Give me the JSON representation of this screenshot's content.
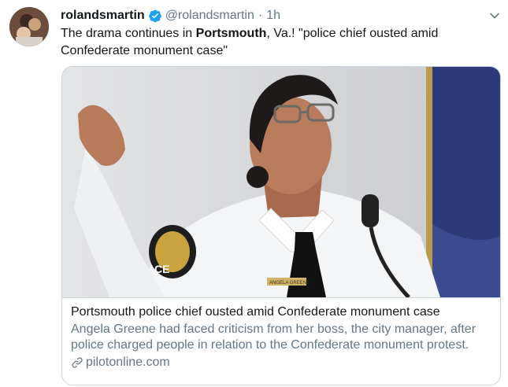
{
  "tweet": {
    "display_name": "rolandsmartin",
    "handle": "@rolandsmartin",
    "separator": "·",
    "time": "1h",
    "text_before": "The drama continues in ",
    "text_bold": "Portsmouth",
    "text_after": ", Va.! \"police chief ousted amid Confederate monument case\"",
    "verified": true
  },
  "card": {
    "title": "Portsmouth police chief ousted amid Confederate monument case",
    "description": "Angela Greene had faced criticism from her boss, the city manager, after police charged people in relation to the Confederate monument protest.",
    "domain": "pilotonline.com",
    "image_name_tag": "ANGELA GREENE",
    "image_badge_text": "CE"
  },
  "colors": {
    "primary_text": "#14171a",
    "secondary_text": "#657786",
    "border": "#ccd6dd",
    "verified_blue": "#1da1f2"
  },
  "icons": {
    "verified": "verified-badge-icon",
    "caret": "chevron-down-icon",
    "link": "link-icon"
  }
}
